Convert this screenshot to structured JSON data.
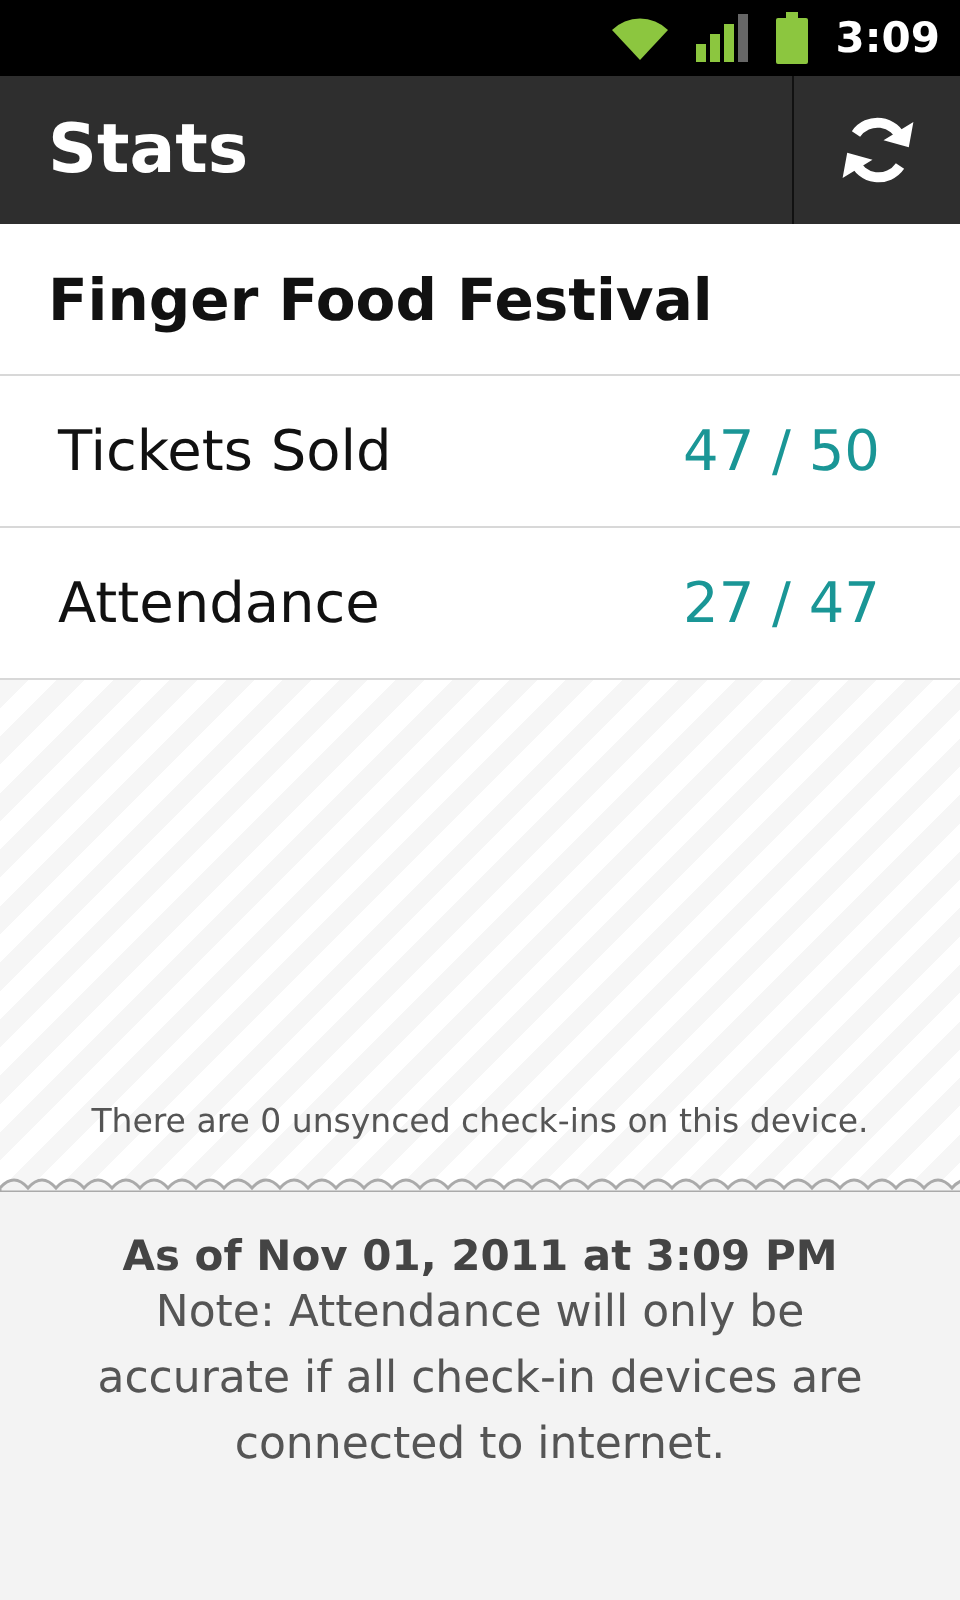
{
  "status_bar": {
    "time": "3:09"
  },
  "action_bar": {
    "title": "Stats"
  },
  "event": {
    "name": "Finger Food Festival"
  },
  "stats": [
    {
      "label": "Tickets Sold",
      "value": "47 / 50"
    },
    {
      "label": "Attendance",
      "value": "27 / 47"
    }
  ],
  "sync_message": "There are 0 unsynced check-ins on this device.",
  "footer": {
    "timestamp": "As of Nov 01, 2011 at 3:09 PM",
    "note": "Note: Attendance will only be accurate if all check-in devices are connected to internet."
  }
}
